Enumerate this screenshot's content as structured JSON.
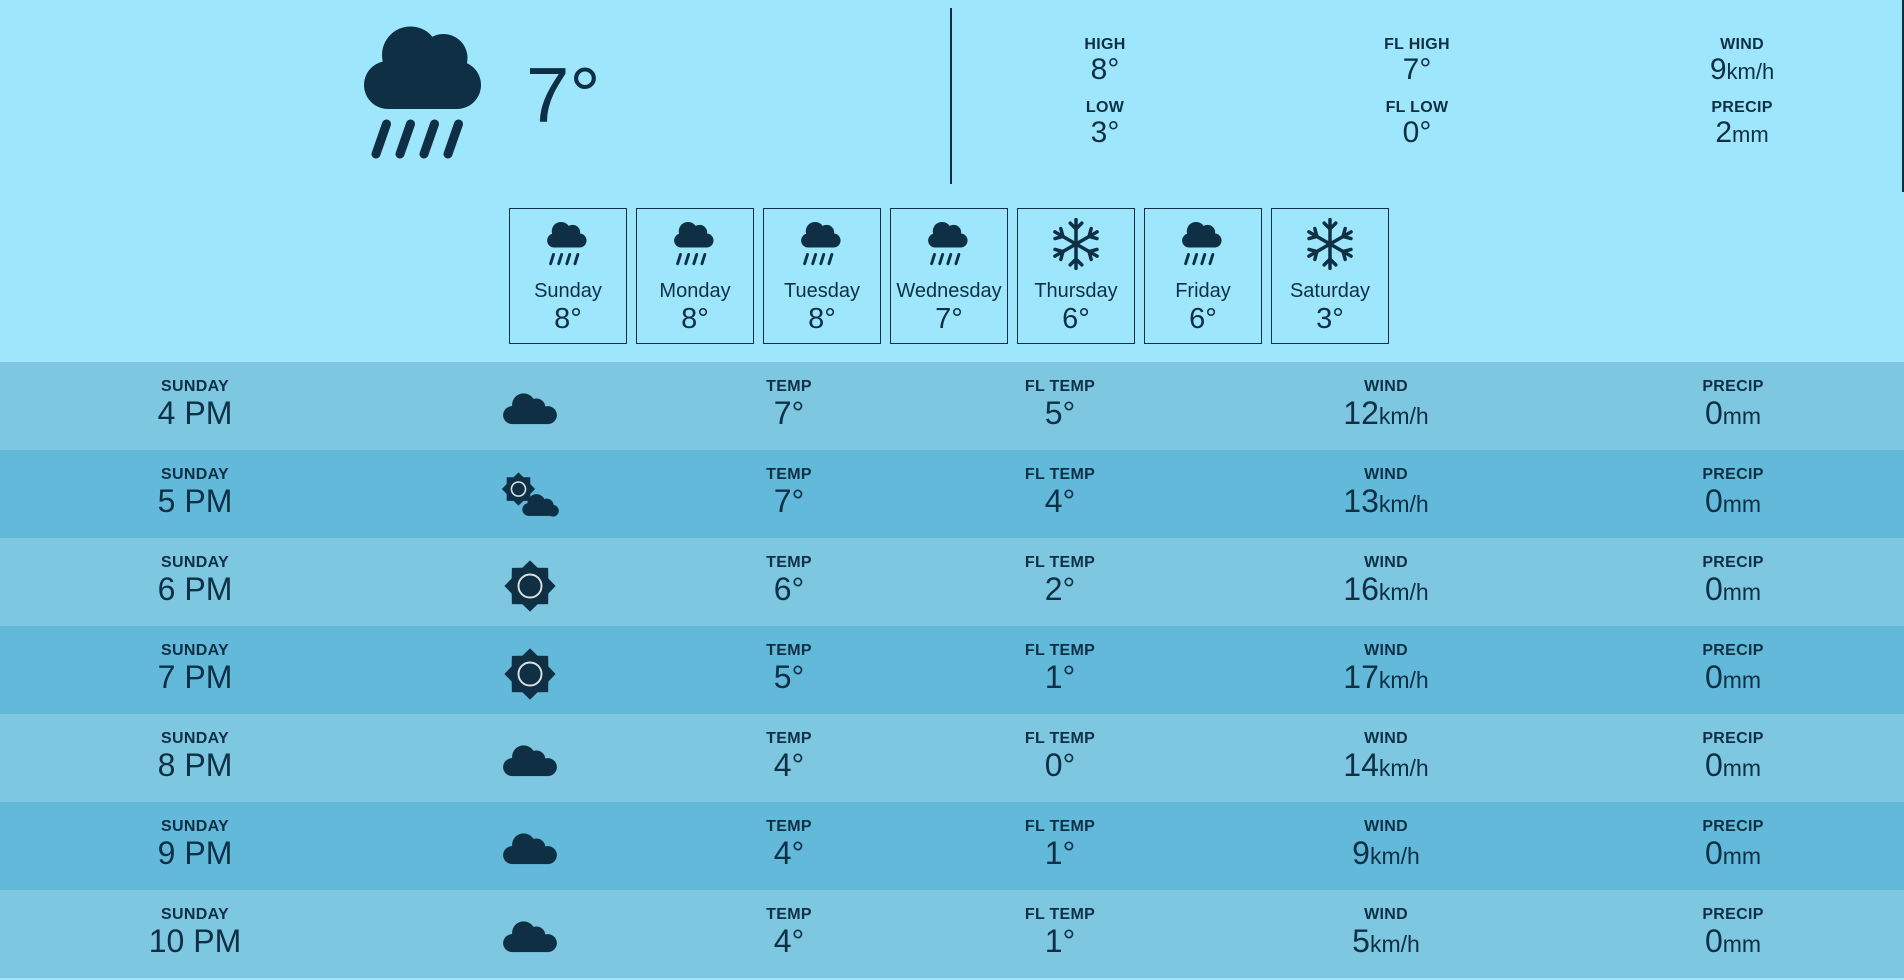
{
  "current": {
    "icon": "rain-cloud-icon",
    "temp": "7°",
    "high_label": "HIGH",
    "high": "8°",
    "low_label": "LOW",
    "low": "3°",
    "fl_high_label": "FL HIGH",
    "fl_high": "7°",
    "fl_low_label": "FL LOW",
    "fl_low": "0°",
    "wind_label": "WIND",
    "wind": "9",
    "wind_unit": "km/h",
    "precip_label": "PRECIP",
    "precip": "2",
    "precip_unit": "mm"
  },
  "daily": [
    {
      "name": "Sunday",
      "temp": "8°",
      "icon": "rain-cloud-icon"
    },
    {
      "name": "Monday",
      "temp": "8°",
      "icon": "rain-cloud-icon"
    },
    {
      "name": "Tuesday",
      "temp": "8°",
      "icon": "rain-cloud-icon"
    },
    {
      "name": "Wednesday",
      "temp": "7°",
      "icon": "rain-cloud-icon"
    },
    {
      "name": "Thursday",
      "temp": "6°",
      "icon": "snowflake-icon"
    },
    {
      "name": "Friday",
      "temp": "6°",
      "icon": "rain-cloud-icon"
    },
    {
      "name": "Saturday",
      "temp": "3°",
      "icon": "snowflake-icon"
    }
  ],
  "hourly_labels": {
    "temp": "TEMP",
    "fl_temp": "FL TEMP",
    "wind": "WIND",
    "precip": "PRECIP",
    "wind_unit": "km/h",
    "precip_unit": "mm"
  },
  "hourly": [
    {
      "day": "SUNDAY",
      "time": "4 PM",
      "icon": "cloud-icon",
      "temp": "7°",
      "fl_temp": "5°",
      "wind": "12",
      "precip": "0"
    },
    {
      "day": "SUNDAY",
      "time": "5 PM",
      "icon": "partly-cloudy-icon",
      "temp": "7°",
      "fl_temp": "4°",
      "wind": "13",
      "precip": "0"
    },
    {
      "day": "SUNDAY",
      "time": "6 PM",
      "icon": "sun-icon",
      "temp": "6°",
      "fl_temp": "2°",
      "wind": "16",
      "precip": "0"
    },
    {
      "day": "SUNDAY",
      "time": "7 PM",
      "icon": "sun-icon",
      "temp": "5°",
      "fl_temp": "1°",
      "wind": "17",
      "precip": "0"
    },
    {
      "day": "SUNDAY",
      "time": "8 PM",
      "icon": "cloud-icon",
      "temp": "4°",
      "fl_temp": "0°",
      "wind": "14",
      "precip": "0"
    },
    {
      "day": "SUNDAY",
      "time": "9 PM",
      "icon": "cloud-icon",
      "temp": "4°",
      "fl_temp": "1°",
      "wind": "9",
      "precip": "0"
    },
    {
      "day": "SUNDAY",
      "time": "10 PM",
      "icon": "cloud-icon",
      "temp": "4°",
      "fl_temp": "1°",
      "wind": "5",
      "precip": "0"
    }
  ],
  "colors": {
    "ink": "#0e2f44",
    "bg": "#9de6fb",
    "row_light": "#7dc7e1",
    "row_dark": "#62b9da"
  }
}
